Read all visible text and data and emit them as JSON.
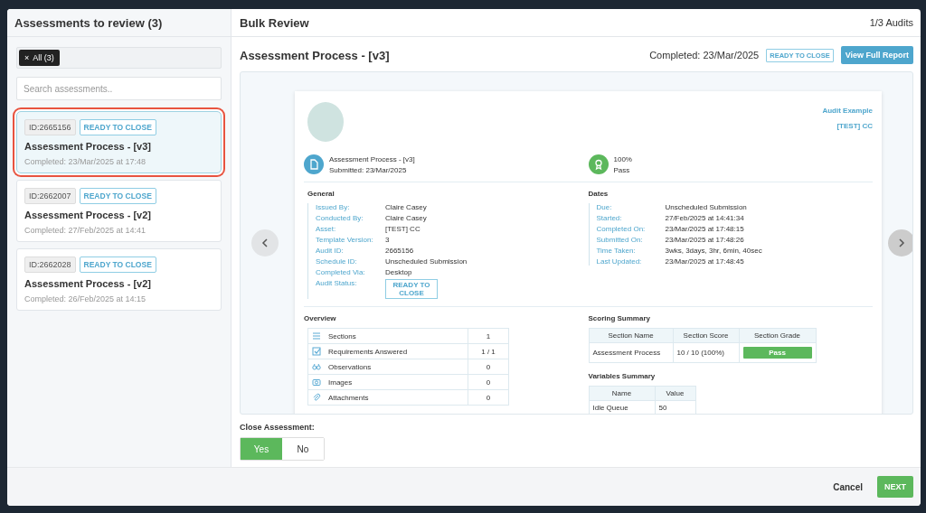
{
  "sidebar": {
    "title": "Assessments to review (3)",
    "filter_chips": [
      {
        "remove": "×",
        "label": "All (3)"
      }
    ],
    "search": {
      "placeholder": "Search assessments.."
    },
    "items": [
      {
        "id": "ID:2665156",
        "status": "READY TO CLOSE",
        "title": "Assessment Process - [v3]",
        "completed": "Completed: 23/Mar/2025 at 17:48",
        "selected": true
      },
      {
        "id": "ID:2662007",
        "status": "READY TO CLOSE",
        "title": "Assessment Process - [v2]",
        "completed": "Completed: 27/Feb/2025 at 14:41",
        "selected": false
      },
      {
        "id": "ID:2662028",
        "status": "READY TO CLOSE",
        "title": "Assessment Process - [v2]",
        "completed": "Completed: 26/Feb/2025 at 14:15",
        "selected": false
      }
    ]
  },
  "review": {
    "title": "Bulk Review",
    "counter": "1/3 Audits",
    "assessment_title": "Assessment Process - [v3]",
    "completed": "Completed: 23/Mar/2025",
    "status": "READY TO CLOSE",
    "view_button": "View Full Report",
    "nav": {
      "previous_disabled": true,
      "next_disabled": false
    },
    "report": {
      "org": "Audit Example",
      "asset": "[TEST] CC",
      "summary": [
        {
          "kind": "document",
          "line1": "Assessment Process - [v3]",
          "line2": "Submitted: 23/Mar/2025"
        },
        {
          "kind": "award",
          "line1": "100%",
          "line2": "Pass"
        }
      ],
      "general": {
        "title": "General",
        "rows": [
          {
            "kind": "text",
            "label": "Issued By:",
            "value": "Claire Casey"
          },
          {
            "kind": "text",
            "label": "Conducted By:",
            "value": "Claire Casey"
          },
          {
            "kind": "text",
            "label": "Asset:",
            "value": "[TEST] CC"
          },
          {
            "kind": "text",
            "label": "Template Version:",
            "value": "3"
          },
          {
            "kind": "text",
            "label": "Audit ID:",
            "value": "2665156"
          },
          {
            "kind": "text",
            "label": "Schedule ID:",
            "value": "Unscheduled Submission"
          },
          {
            "kind": "text",
            "label": "Completed Via:",
            "value": "Desktop"
          },
          {
            "kind": "badge",
            "label": "Audit Status:",
            "value": "READY TO CLOSE"
          }
        ]
      },
      "dates": {
        "title": "Dates",
        "rows": [
          {
            "kind": "text",
            "label": "Due:",
            "value": "Unscheduled Submission"
          },
          {
            "kind": "text",
            "label": "Started:",
            "value": "27/Feb/2025 at 14:41:34"
          },
          {
            "kind": "text",
            "label": "Completed On:",
            "value": "23/Mar/2025 at 17:48:15"
          },
          {
            "kind": "text",
            "label": "Submitted On:",
            "value": "23/Mar/2025 at 17:48:26"
          },
          {
            "kind": "text",
            "label": "Time Taken:",
            "value": "3wks, 3days, 3hr, 6min, 40sec"
          },
          {
            "kind": "text",
            "label": "Last Updated:",
            "value": "23/Mar/2025 at 17:48:45"
          }
        ]
      },
      "overview": {
        "title": "Overview",
        "rows": [
          {
            "kind": "sections",
            "label": "Sections",
            "value": "1"
          },
          {
            "kind": "requirements",
            "label": "Requirements Answered",
            "value": "1 / 1"
          },
          {
            "kind": "observations",
            "label": "Observations",
            "value": "0"
          },
          {
            "kind": "images",
            "label": "Images",
            "value": "0"
          },
          {
            "kind": "attachments",
            "label": "Attachments",
            "value": "0"
          }
        ]
      },
      "scoring": {
        "title": "Scoring Summary",
        "columns": [
          "Section Name",
          "Section Score",
          "Section Grade"
        ],
        "rows": [
          {
            "name": "Assessment Process",
            "score": "10 / 10 (100%)",
            "grade": "Pass"
          }
        ]
      },
      "variables": {
        "title": "Variables Summary",
        "columns": [
          "Name",
          "Value"
        ],
        "rows": [
          {
            "name": "Idle Queue",
            "value": "50"
          }
        ]
      }
    }
  },
  "close_assessment": {
    "label": "Close Assessment:",
    "options": [
      {
        "label": "Yes",
        "selected": true
      },
      {
        "label": "No",
        "selected": false
      }
    ]
  },
  "footer": {
    "cancel": "Cancel",
    "next": "NEXT"
  }
}
